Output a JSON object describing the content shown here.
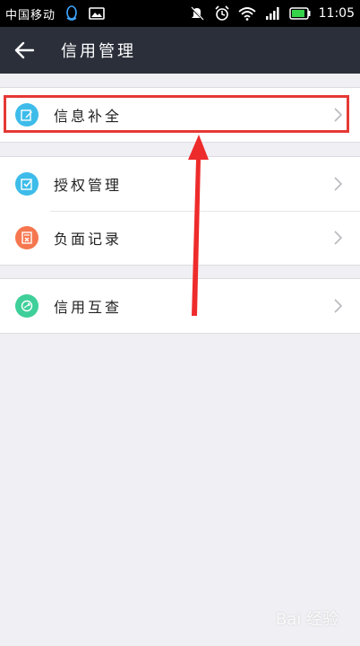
{
  "status_bar": {
    "carrier": "中国移动",
    "time": "11:05"
  },
  "nav": {
    "title": "信用管理"
  },
  "groups": [
    {
      "items": [
        {
          "label": "信息补全",
          "icon": "edit-icon",
          "color": "#3dbcea"
        }
      ]
    },
    {
      "items": [
        {
          "label": "授权管理",
          "icon": "check-square-icon",
          "color": "#3dbcea"
        },
        {
          "label": "负面记录",
          "icon": "document-x-icon",
          "color": "#f6774f"
        }
      ]
    },
    {
      "items": [
        {
          "label": "信用互查",
          "icon": "exchange-icon",
          "color": "#3fcf9a"
        }
      ]
    }
  ],
  "colors": {
    "nav_bg": "#2b2f3a",
    "page_bg": "#efeff4",
    "annotation_red": "#e53935"
  },
  "watermark": "Bai 经验"
}
